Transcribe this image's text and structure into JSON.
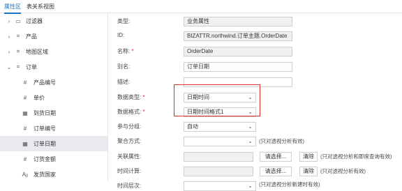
{
  "tabs": [
    {
      "label": "属性区"
    },
    {
      "label": "表关系视图"
    }
  ],
  "tree": [
    {
      "label": "过滤器",
      "icon": "folder-icon",
      "glyph": "▭",
      "expand": "›"
    },
    {
      "label": "产品",
      "icon": "table-icon",
      "glyph": "⌗",
      "expand": "›"
    },
    {
      "label": "地图区域",
      "icon": "table-icon",
      "glyph": "⌗",
      "expand": "›"
    },
    {
      "label": "订单",
      "icon": "table-icon",
      "glyph": "⌗",
      "expand": "⌄"
    },
    {
      "label": "产品编号",
      "icon": "number-field-icon",
      "glyph": "#"
    },
    {
      "label": "单价",
      "icon": "number-field-icon",
      "glyph": "#"
    },
    {
      "label": "到货日期",
      "icon": "date-field-icon",
      "glyph": "▦"
    },
    {
      "label": "订单编号",
      "icon": "number-field-icon",
      "glyph": "#"
    },
    {
      "label": "订单日期",
      "icon": "date-field-icon",
      "glyph": "▦"
    },
    {
      "label": "订货金额",
      "icon": "number-field-icon",
      "glyph": "#"
    },
    {
      "label": "发货国家",
      "icon": "text-field-icon",
      "glyph": "Aᵦ"
    }
  ],
  "form": {
    "type": {
      "label": "类型:",
      "value": "业务属性"
    },
    "id": {
      "label": "ID:",
      "value": "BIZATTR.northwind.订单主题.OrderDate"
    },
    "name": {
      "label": "名称:",
      "required": "*",
      "value": "OrderDate"
    },
    "alias": {
      "label": "别名:",
      "value": "订单日期"
    },
    "desc": {
      "label": "描述:",
      "value": ""
    },
    "data_type": {
      "label": "数据类型:",
      "required": "*",
      "value": "日期时间"
    },
    "data_format": {
      "label": "数据格式:",
      "required": "*",
      "value": "日期时间格式1"
    },
    "group": {
      "label": "参与分组:",
      "value": "自动"
    },
    "agg": {
      "label": "聚合方式:",
      "value": "",
      "hint": "(只对透视分析有效)"
    },
    "link": {
      "label": "关联属性:",
      "choose": "请选择...",
      "clear": "清除",
      "hint": "(只对透视分析和即席查询有效)"
    },
    "calc": {
      "label": "时间计算:",
      "choose": "请选择...",
      "clear": "清除",
      "hint": "(只对透视分析有效)"
    },
    "level": {
      "label": "时间层次:",
      "hint": "(只对透视分析新建时有效)"
    }
  },
  "chevron": "⌄"
}
